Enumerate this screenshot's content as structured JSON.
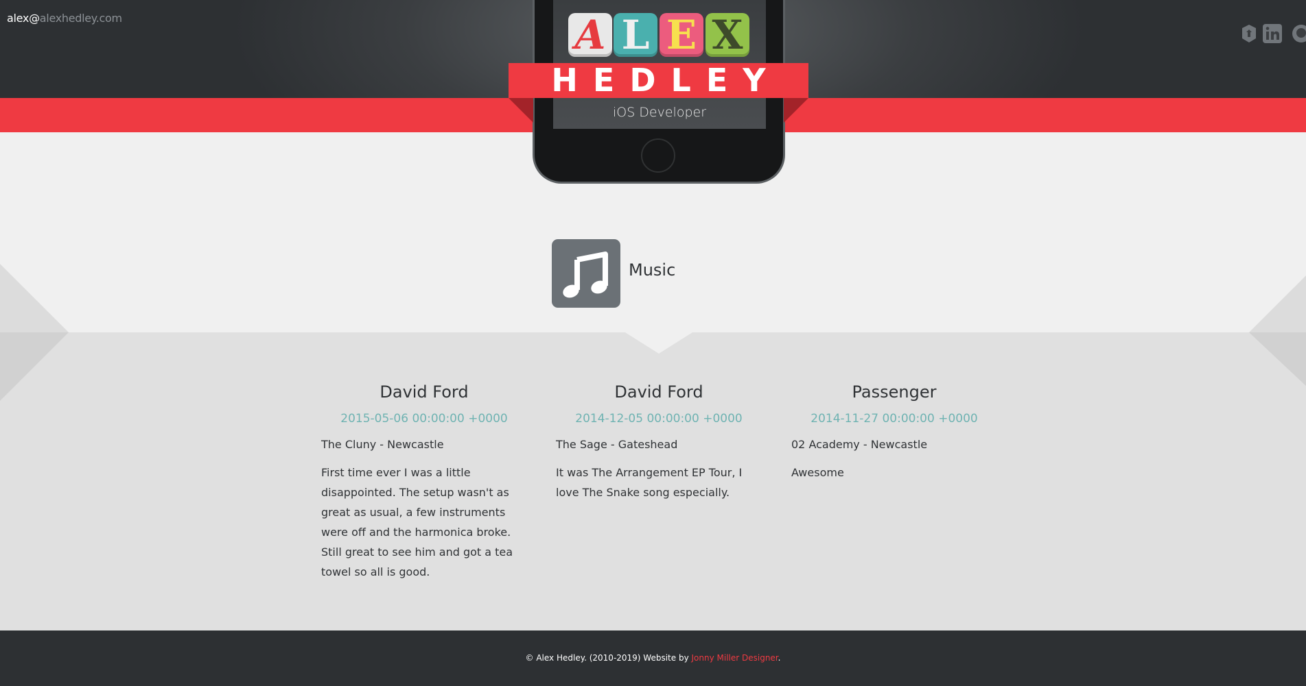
{
  "header": {
    "email_user": "alex@",
    "email_domain": "alexhedley.com",
    "logo_letters": [
      "A",
      "L",
      "E",
      "X"
    ],
    "logo_colors": [
      "#e8e8e8",
      "#4ab0ae",
      "#ec5c7e",
      "#93c24a"
    ],
    "logo_text_colors": [
      "#e63a3f",
      "#f0f0f0",
      "#f7e04e",
      "#3d4a2a"
    ],
    "surname": "HEDLEY",
    "tagline": "iOS Developer",
    "social_icons": [
      "treehouse-icon",
      "linkedin-icon",
      "github-icon"
    ]
  },
  "section": {
    "title": "Music",
    "icon": "music-note-icon"
  },
  "gigs": [
    {
      "artist": "David Ford",
      "date": "2015-05-06 00:00:00 +0000",
      "venue": "The Cluny - Newcastle",
      "notes": "First time ever I was a little disappointed. The setup wasn't as great as usual, a few instruments were off and the harmonica broke. Still great to see him and got a tea towel so all is good."
    },
    {
      "artist": "David Ford",
      "date": "2014-12-05 00:00:00 +0000",
      "venue": "The Sage - Gateshead",
      "notes": "It was The Arrangement EP Tour, I love The Snake song especially."
    },
    {
      "artist": "Passenger",
      "date": "2014-11-27 00:00:00 +0000",
      "venue": "02 Academy - Newcastle",
      "notes": "Awesome"
    }
  ],
  "footer": {
    "text": "© Alex Hedley. (2010-2019) Website by ",
    "link": "Jonny Miller Designer",
    "suffix": "."
  },
  "colors": {
    "accent": "#ef3a42",
    "date": "#6fb3b2",
    "header_dark": "#2d3033"
  }
}
